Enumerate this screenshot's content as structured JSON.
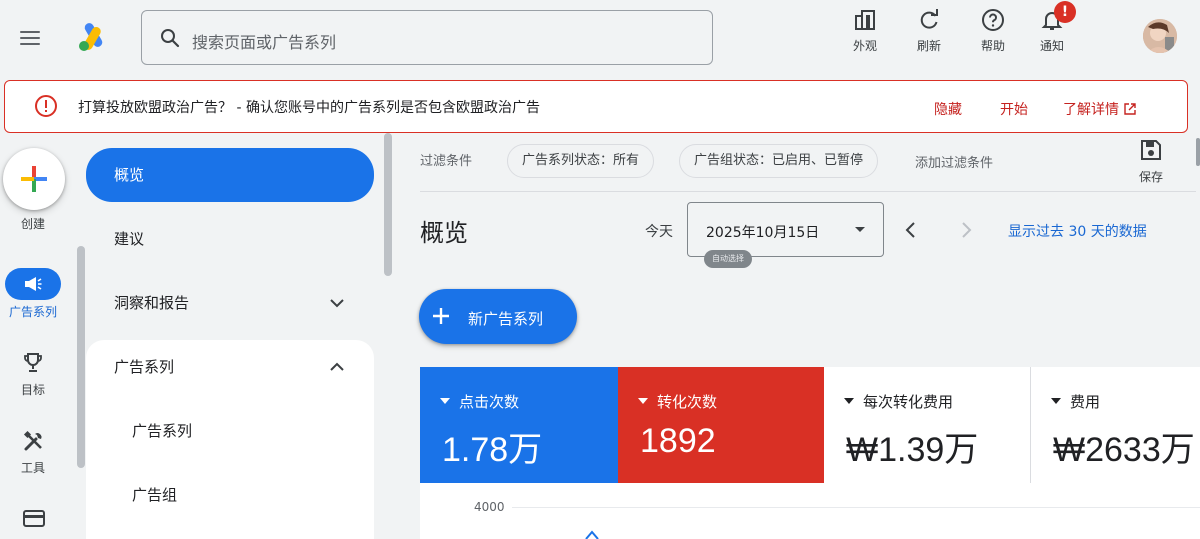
{
  "topbar": {
    "search_placeholder": "搜索页面或广告系列",
    "tools": {
      "appearance": "外观",
      "refresh": "刷新",
      "help": "帮助",
      "notifications": "通知"
    },
    "notification_badge": "!"
  },
  "alert": {
    "message": "打算投放欧盟政治广告？ - 确认您账号中的广告系列是否包含欧盟政治广告",
    "hide": "隐藏",
    "start": "开始",
    "learn_more": "了解详情"
  },
  "rail": {
    "create": "创建",
    "items": [
      {
        "label": "广告系列",
        "icon": "megaphone-icon",
        "active": true
      },
      {
        "label": "目标",
        "icon": "trophy-icon",
        "active": false
      },
      {
        "label": "工具",
        "icon": "tools-icon",
        "active": false
      },
      {
        "label": "结算",
        "icon": "credit-card-icon",
        "active": false
      }
    ]
  },
  "nav": {
    "items": [
      {
        "label": "概览",
        "active": true
      },
      {
        "label": "建议"
      },
      {
        "label": "洞察和报告",
        "expandable": true,
        "expanded": false
      },
      {
        "label": "广告系列",
        "expandable": true,
        "expanded": true
      },
      {
        "label": "广告系列",
        "sub": true
      },
      {
        "label": "广告组",
        "sub": true
      }
    ]
  },
  "filters": {
    "label": "过滤条件",
    "chips": [
      "广告系列状态：所有",
      "广告组状态：已启用、已暂停"
    ],
    "add": "添加过滤条件",
    "save": "保存"
  },
  "main": {
    "title": "概览",
    "today": "今天",
    "date_value": "2025年10月15日",
    "date_tooltip": "自动选择",
    "last30": "显示过去 30 天的数据",
    "new_campaign": "新广告系列"
  },
  "metrics": [
    {
      "label": "点击次数",
      "value": "1.78万",
      "color": "#1a73e8"
    },
    {
      "label": "转化次数",
      "value": "1892",
      "color": "#d93025"
    },
    {
      "label": "每次转化费用",
      "value": "₩1.39万",
      "color": "#ffffff"
    },
    {
      "label": "费用",
      "value": "₩2633万",
      "color": "#ffffff"
    }
  ],
  "chart": {
    "y_tick_top": "4000"
  },
  "colors": {
    "accent": "#1a73e8",
    "alert": "#d93025",
    "link": "#1967d2"
  }
}
